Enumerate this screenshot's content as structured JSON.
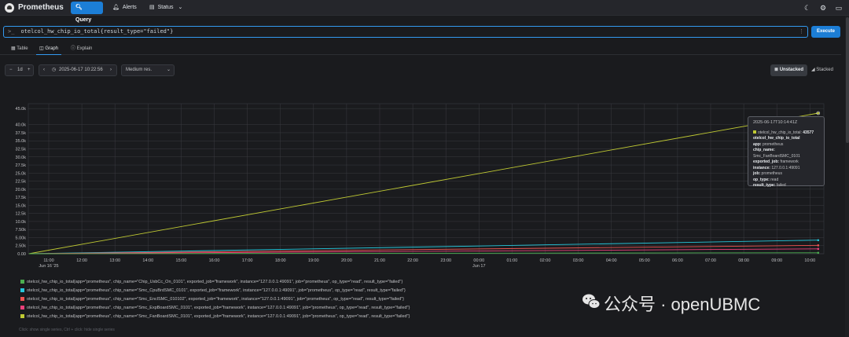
{
  "app": {
    "title": "Prometheus"
  },
  "nav": {
    "query": "Query",
    "alerts": "Alerts",
    "status": "Status"
  },
  "expression": {
    "prompt": ">_",
    "value": "otelcol_hw_chip_io_total{result_type=\"failed\"}"
  },
  "execute_label": "Execute",
  "tabs": {
    "table": "Table",
    "graph": "Graph",
    "explain": "Explain"
  },
  "controls": {
    "range": "1d",
    "end_time": "2025-06-17 10:22:56",
    "resolution": "Medium res.",
    "unstacked": "Unstacked",
    "stacked": "Stacked"
  },
  "tooltip": {
    "time": "2025-06-17T10:14:41Z",
    "metric": "otelcol_hw_chip_io_total:",
    "value": "43577",
    "labels": [
      {
        "k": "otelcol_hw_chip_io_total",
        "v": ""
      },
      {
        "k": "app:",
        "v": "prometheus"
      },
      {
        "k": "chip_name:",
        "v": "Smc_FanBoardSMC_0101"
      },
      {
        "k": "exported_job:",
        "v": "framework"
      },
      {
        "k": "instance:",
        "v": "127.0.0.1:49091"
      },
      {
        "k": "job:",
        "v": "prometheus"
      },
      {
        "k": "op_type:",
        "v": "read"
      },
      {
        "k": "result_type:",
        "v": "failed"
      }
    ]
  },
  "legend": [
    {
      "color": "#4caf50",
      "text": "otelcol_hw_chip_io_total{app=\"prometheus\", chip_name=\"Chip_UsbCc_On_0101\", exported_job=\"framework\", instance=\"127.0.0.1:49091\", job=\"prometheus\", op_type=\"read\", result_type=\"failed\"}"
    },
    {
      "color": "#26c6da",
      "text": "otelcol_hw_chip_io_total{app=\"prometheus\", chip_name=\"Smc_CpuBrdSMC_0101\", exported_job=\"framework\", instance=\"127.0.0.1:49091\", job=\"prometheus\", op_type=\"read\", result_type=\"failed\"}"
    },
    {
      "color": "#ef5350",
      "text": "otelcol_hw_chip_io_total{app=\"prometheus\", chip_name=\"Smc_EnclSMC_010102\", exported_job=\"framework\", instance=\"127.0.0.1:49091\", job=\"prometheus\", op_type=\"read\", result_type=\"failed\"}"
    },
    {
      "color": "#ec407a",
      "text": "otelcol_hw_chip_io_total{app=\"prometheus\", chip_name=\"Smc_ExpBoardSMC_0101\", exported_job=\"framework\", instance=\"127.0.0.1:49091\", job=\"prometheus\", op_type=\"read\", result_type=\"failed\"}"
    },
    {
      "color": "#c0ca33",
      "text": "otelcol_hw_chip_io_total{app=\"prometheus\", chip_name=\"Smc_FanBoardSMC_0101\", exported_job=\"framework\", instance=\"127.0.0.1:49091\", job=\"prometheus\", op_type=\"read\", result_type=\"failed\"}"
    }
  ],
  "hint": "Click: show single series, Ctrl + click: hide single series",
  "watermark": "公众号 · openUBMC",
  "chart_data": {
    "type": "line",
    "y_ticks": [
      "0.00",
      "2.50k",
      "5.00k",
      "7.50k",
      "10.0k",
      "12.5k",
      "15.0k",
      "17.5k",
      "20.0k",
      "22.5k",
      "25.0k",
      "27.5k",
      "30.0k",
      "32.5k",
      "35.0k",
      "37.5k",
      "40.0k",
      "45.0k"
    ],
    "ylim": [
      0,
      46500
    ],
    "x_ticks": [
      "11:00",
      "12:00",
      "13:00",
      "14:00",
      "15:00",
      "16:00",
      "17:00",
      "18:00",
      "19:00",
      "20:00",
      "21:00",
      "22:00",
      "23:00",
      "00:00",
      "01:00",
      "02:00",
      "03:00",
      "04:00",
      "05:00",
      "06:00",
      "07:00",
      "08:00",
      "09:00",
      "10:00"
    ],
    "x_sublabels": {
      "0": "Jun 16 '25",
      "13": "Jun 17"
    },
    "grid": true,
    "series": [
      {
        "name": "Smc_FanBoardSMC_0101",
        "color": "#c0ca33",
        "x": [
          -0.6,
          23.25
        ],
        "values": [
          0,
          43577
        ]
      },
      {
        "name": "Smc_CpuBrdSMC_0101",
        "color": "#26c6da",
        "x": [
          -0.6,
          23.25
        ],
        "values": [
          0,
          4200
        ]
      },
      {
        "name": "Smc_EnclSMC_010102",
        "color": "#ef5350",
        "x": [
          -0.6,
          23.25
        ],
        "values": [
          0,
          2600
        ]
      },
      {
        "name": "Smc_ExpBoardSMC_0101",
        "color": "#ec407a",
        "x": [
          -0.6,
          23.25
        ],
        "values": [
          0,
          1500
        ]
      },
      {
        "name": "Chip_UsbCc_On_0101",
        "color": "#4caf50",
        "x": [
          -0.6,
          23.25
        ],
        "values": [
          0,
          300
        ]
      }
    ]
  }
}
